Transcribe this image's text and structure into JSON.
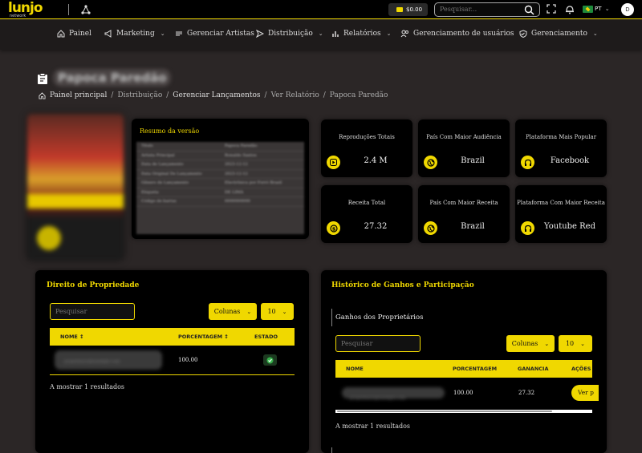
{
  "topbar": {
    "logo": "lunjo",
    "logo_sub": "network",
    "balance": "$0.00",
    "search_placeholder": "Pesquisar...",
    "lang": "PT",
    "avatar_initial": "D"
  },
  "nav": [
    {
      "label": "Painel",
      "icon": "home-icon",
      "has_menu": false
    },
    {
      "label": "Marketing",
      "icon": "megaphone-icon",
      "has_menu": true
    },
    {
      "label": "Gerenciar Artistas",
      "icon": "music-icon",
      "has_menu": false
    },
    {
      "label": "Distribuição",
      "icon": "send-icon",
      "has_menu": true
    },
    {
      "label": "Relatórios",
      "icon": "bar-chart-icon",
      "has_menu": true
    },
    {
      "label": "Gerenciamento de usuários",
      "icon": "users-icon",
      "has_menu": true
    },
    {
      "label": "Gerenciamento",
      "icon": "shield-icon",
      "has_menu": true
    }
  ],
  "header": {
    "title": "Papoca Paredão",
    "breadcrumb": [
      "Painel principal",
      "Distribuição",
      "Gerenciar Lançamentos",
      "Ver Relatório",
      "Papoca Paredão"
    ]
  },
  "resumo": {
    "title": "Resumo da versão",
    "rows": [
      [
        "Título",
        "Papoca Paredão"
      ],
      [
        "Artista Principal",
        "Ronaldo Santos"
      ],
      [
        "Data de Lançamento",
        "2023-12-12"
      ],
      [
        "Data Original De Lançamento",
        "2023-12-12"
      ],
      [
        "Gênero de Lançamento",
        "Electrônica por Forró Brasil"
      ],
      [
        "Etiqueta",
        "DE LIMA"
      ],
      [
        "Código de barras",
        "0000000000"
      ]
    ]
  },
  "stats": [
    {
      "label": "Reproduções Totais",
      "value": "2.4 M",
      "icon": "play-icon"
    },
    {
      "label": "País Com Maior Audiência",
      "value": "Brazil",
      "icon": "globe-icon"
    },
    {
      "label": "Plataforma Mais Popular",
      "value": "Facebook",
      "icon": "headphones-icon"
    },
    {
      "label": "Receita Total",
      "value": "27.32",
      "icon": "dollar-icon"
    },
    {
      "label": "País Com Maior Receita",
      "value": "Brazil",
      "icon": "globe-icon"
    },
    {
      "label": "Plataforma Com Maior Receita",
      "value": "Youtube Red",
      "icon": "headphones-icon"
    }
  ],
  "direito": {
    "title": "Direito de Propriedade",
    "search_placeholder": "Pesquisar",
    "columns_btn": "Colunas",
    "page_size": "10",
    "headers": [
      "NOME",
      "PORCENTAGEM",
      "ESTADO"
    ],
    "row": {
      "name": "proprietario@exemplo.com",
      "percentage": "100.00"
    },
    "results": "A mostrar 1 resultados"
  },
  "historico": {
    "title": "Histórico de Ganhos e Participação",
    "subtitle": "Ganhos dos Proprietários",
    "search_placeholder": "Pesquisar",
    "columns_btn": "Colunas",
    "page_size": "10",
    "headers": [
      "NOME",
      "PORCENTAGEM",
      "GANANCIA",
      "AÇÕES"
    ],
    "row": {
      "name": "proprietario@exemplo.com",
      "percentage": "100.00",
      "gain": "27.32",
      "action": "Ver p"
    },
    "results": "A mostrar 1 resultados"
  }
}
